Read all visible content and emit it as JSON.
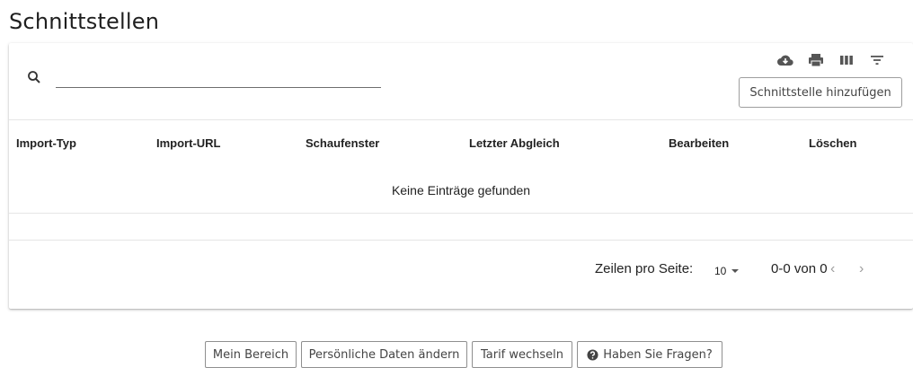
{
  "page": {
    "title": "Schnittstellen"
  },
  "search": {
    "placeholder": "",
    "value": ""
  },
  "toolbar": {
    "icons": [
      "download-icon",
      "print-icon",
      "columns-icon",
      "filter-icon"
    ],
    "add_button": "Schnittstelle hinzufügen"
  },
  "table": {
    "columns": [
      "Import-Typ",
      "Import-URL",
      "Schaufenster",
      "Letzter Abgleich",
      "Bearbeiten",
      "Löschen"
    ],
    "empty_message": "Keine Einträge gefunden"
  },
  "pagination": {
    "rows_per_page_label": "Zeilen pro Seite:",
    "rows_per_page": "10",
    "range": "0-0 von 0",
    "prev": "‹",
    "next": "›"
  },
  "footer_nav": {
    "mein_bereich": "Mein Bereich",
    "persoenliche_daten": "Persönliche Daten ändern",
    "tarif": "Tarif wechseln",
    "fragen": "Haben Sie Fragen?"
  },
  "colors": {
    "icon": "#555555",
    "border": "#9e9e9e"
  }
}
